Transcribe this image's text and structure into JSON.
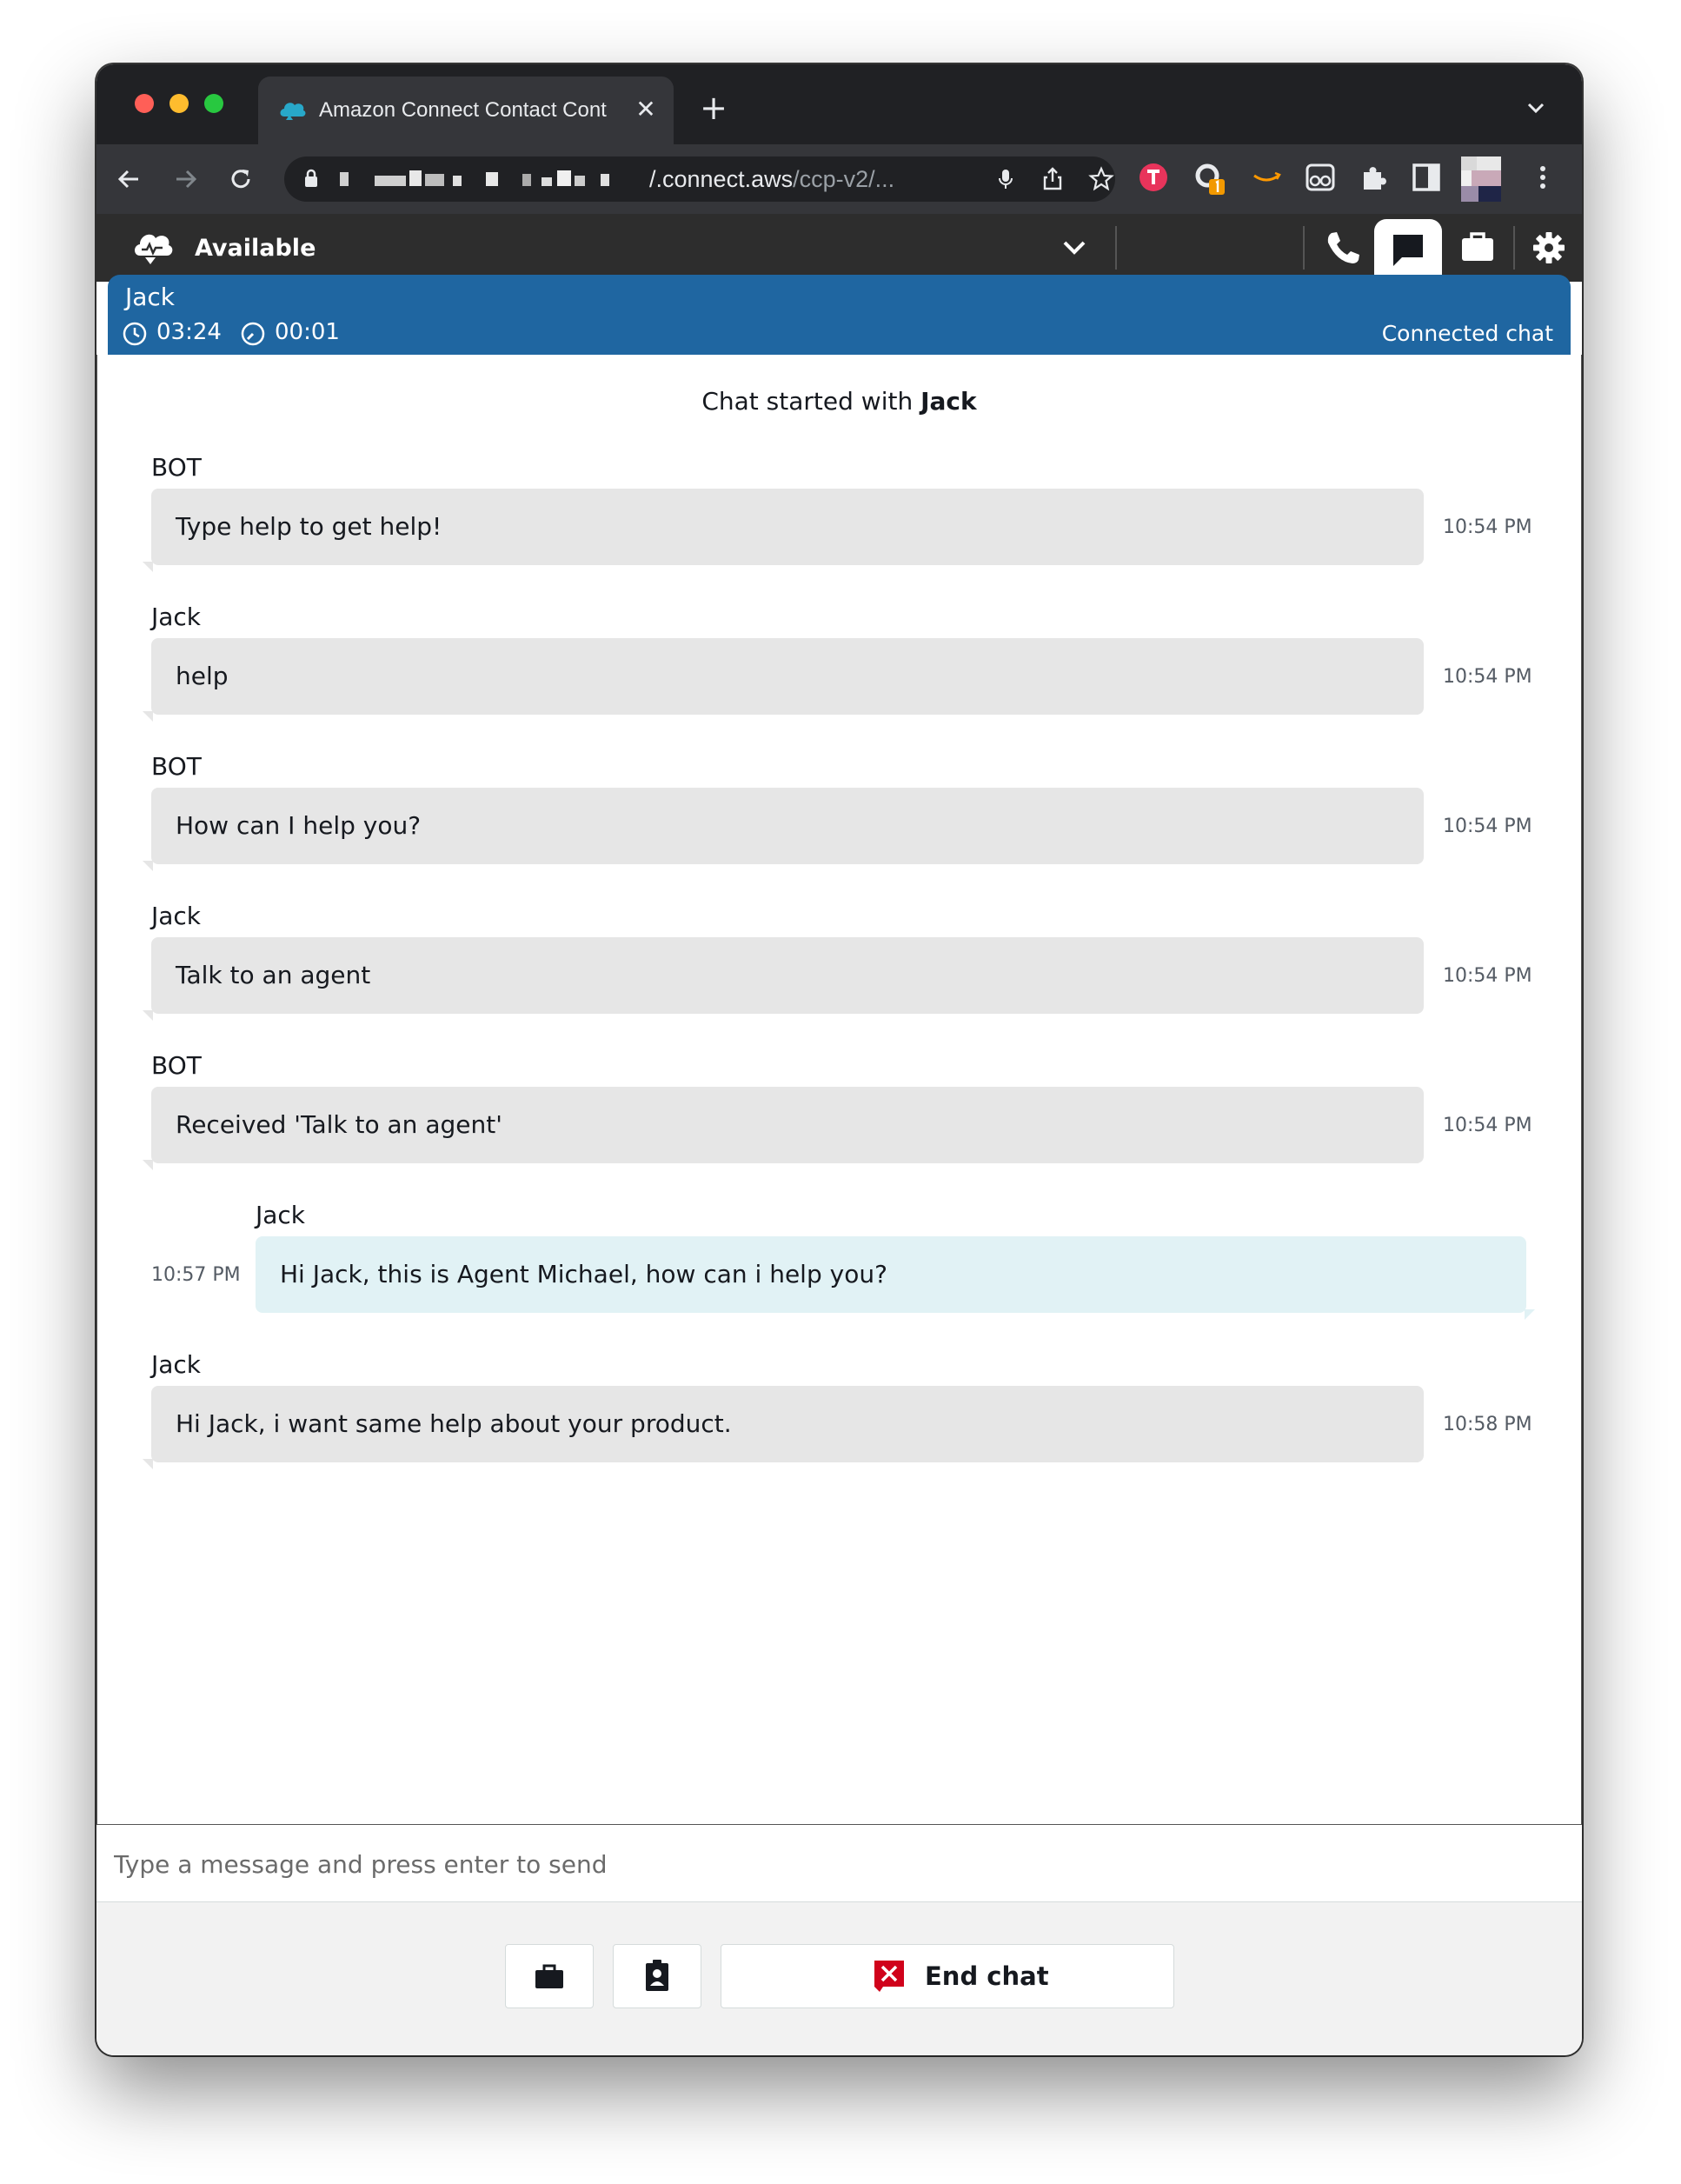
{
  "browser": {
    "tab_title": "Amazon Connect Contact Cont",
    "url_host": "/.connect.aws",
    "url_path": "/ccp-v2/..."
  },
  "ccp": {
    "agent_status": "Available",
    "icons": [
      "phone-icon",
      "chat-icon",
      "briefcase-icon",
      "gear-icon"
    ]
  },
  "contact": {
    "name": "Jack",
    "contact_duration": "03:24",
    "state_duration": "00:01",
    "state": "Connected chat"
  },
  "chat": {
    "started_prefix": "Chat started with ",
    "started_name": "Jack",
    "messages": [
      {
        "sender": "BOT",
        "text": "Type help to get help!",
        "time": "10:54 PM",
        "side": "customer"
      },
      {
        "sender": "Jack",
        "text": "help",
        "time": "10:54 PM",
        "side": "customer"
      },
      {
        "sender": "BOT",
        "text": "How can I help you?",
        "time": "10:54 PM",
        "side": "customer"
      },
      {
        "sender": "Jack",
        "text": "Talk to an agent",
        "time": "10:54 PM",
        "side": "customer"
      },
      {
        "sender": "BOT",
        "text": "Received 'Talk to an agent'",
        "time": "10:54 PM",
        "side": "customer"
      },
      {
        "sender": "Jack",
        "text": "Hi Jack, this is Agent Michael, how can i help you?",
        "time": "10:57 PM",
        "side": "agent"
      },
      {
        "sender": "Jack",
        "text": "Hi Jack, i want same help about your product.",
        "time": "10:58 PM",
        "side": "customer"
      }
    ]
  },
  "composer": {
    "placeholder": "Type a message and press enter to send",
    "end_chat_label": "End chat"
  },
  "colors": {
    "contact_header": "#1f66a1",
    "agent_bubble": "#e1f2f5",
    "customer_bubble": "#e6e6e6",
    "end_chat_icon": "#d0021b"
  }
}
